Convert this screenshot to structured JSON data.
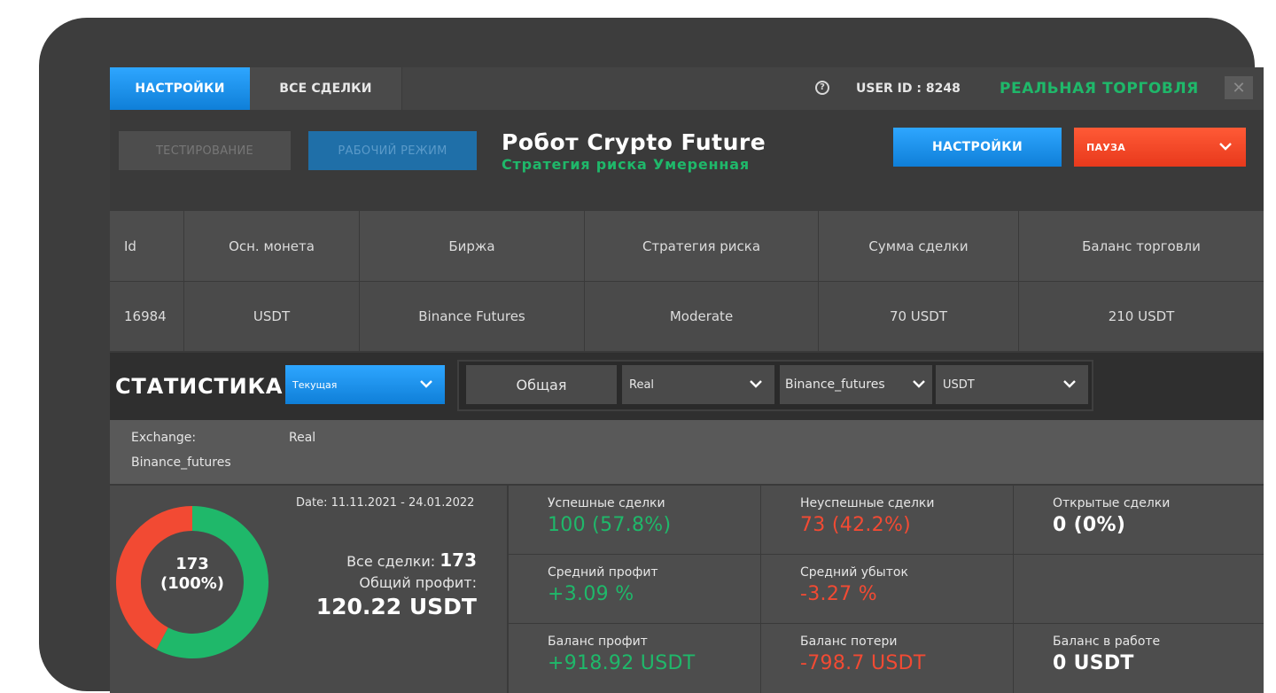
{
  "tabs": {
    "settings": "НАСТРОЙКИ",
    "all_trades": "ВСЕ СДЕЛКИ"
  },
  "header": {
    "user_id": "USER ID : 8248",
    "mode": "РЕАЛЬНАЯ ТОРГОВЛЯ",
    "help_glyph": "?",
    "close_glyph": "✕"
  },
  "controls": {
    "test_label": "ТЕСТИРОВАНИЕ",
    "work_label": "РАБОЧИЙ РЕЖИМ",
    "robot_title": "Робот Crypto Future",
    "robot_strategy": "Стратегия риска Умеренная",
    "settings_label": "НАСТРОЙКИ",
    "pause_label": "ПАУЗА"
  },
  "table": {
    "headers": [
      "Id",
      "Осн. монета",
      "Биржа",
      "Стратегия риска",
      "Сумма сделки",
      "Баланс торговли"
    ],
    "row": [
      "16984",
      "USDT",
      "Binance Futures",
      "Moderate",
      "70 USDT",
      "210 USDT"
    ]
  },
  "stats_bar": {
    "title": "СТАТИСТИКА",
    "period": "Текущая",
    "general": "Общая",
    "mode": "Real",
    "exchange": "Binance_futures",
    "coin": "USDT"
  },
  "exchange_info": {
    "label": "Exchange:",
    "value": "Binance_futures",
    "mode": "Real"
  },
  "summary": {
    "donut_count": "173",
    "donut_pct": "(100%)",
    "date": "Date: 11.11.2021 - 24.01.2022",
    "all_trades_label": "Все сделки:",
    "all_trades_value": "173",
    "profit_label": "Общий профит:",
    "profit_value": "120.22 USDT",
    "success_fraction": 0.578,
    "colors": {
      "success": "#1fb86a",
      "fail": "#f24a33"
    }
  },
  "grid": [
    {
      "label": "Успешные сделки",
      "value": "100 (57.8%)",
      "tone": "green"
    },
    {
      "label": "Неуспешные сделки",
      "value": "73 (42.2%)",
      "tone": "red"
    },
    {
      "label": "Открытые сделки",
      "value": "0 (0%)",
      "tone": "white"
    },
    {
      "label": "Средний профит",
      "value": "+3.09 %",
      "tone": "green"
    },
    {
      "label": "Средний убыток",
      "value": "-3.27 %",
      "tone": "red"
    },
    {
      "label": "",
      "value": "",
      "tone": "white"
    },
    {
      "label": "Баланс профит",
      "value": "+918.92 USDT",
      "tone": "green"
    },
    {
      "label": "Баланс потери",
      "value": "-798.7 USDT",
      "tone": "red"
    },
    {
      "label": "Баланс в работе",
      "value": "0 USDT",
      "tone": "white"
    }
  ]
}
